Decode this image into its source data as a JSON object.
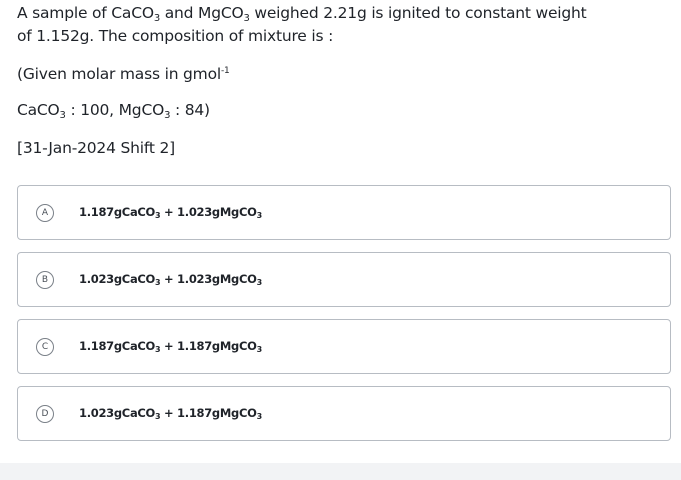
{
  "question": {
    "line1": {
      "p1": "A sample of CaCO",
      "s1": "3",
      "p2": " and MgCO",
      "s2": "3",
      "p3": " weighed 2.21g is ignited to constant weight"
    },
    "line2": "of 1.152g. The composition of mixture is :",
    "given": {
      "prefix": "(Given molar mass in gmol",
      "sup": "-1"
    },
    "masses": {
      "p1": "CaCO",
      "s1": "3",
      "p2": " : 100, MgCO",
      "s2": "3",
      "p3": " : 84)"
    },
    "source": "[31-Jan-2024 Shift 2]"
  },
  "options": [
    {
      "letter": "A",
      "a": "1.187gCaCO",
      "a_sub": "3",
      "b": " + 1.023gMgCO",
      "b_sub": "3"
    },
    {
      "letter": "B",
      "a": "1.023gCaCO",
      "a_sub": "3",
      "b": " + 1.023gMgCO",
      "b_sub": "3"
    },
    {
      "letter": "C",
      "a": "1.187gCaCO",
      "a_sub": "3",
      "b": " + 1.187gMgCO",
      "b_sub": "3"
    },
    {
      "letter": "D",
      "a": "1.023gCaCO",
      "a_sub": "3",
      "b": " + 1.187gMgCO",
      "b_sub": "3"
    }
  ]
}
